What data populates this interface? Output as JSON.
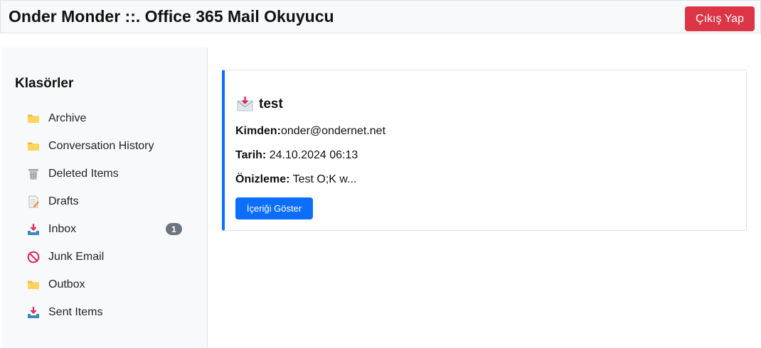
{
  "header": {
    "title": "Onder Monder ::. Office 365 Mail Okuyucu",
    "logout_label": "Çıkış Yap"
  },
  "sidebar": {
    "title": "Klasörler",
    "folders": [
      {
        "label": "Archive",
        "icon": "folder-icon",
        "badge": ""
      },
      {
        "label": "Conversation History",
        "icon": "folder-icon",
        "badge": ""
      },
      {
        "label": "Deleted Items",
        "icon": "trash-icon",
        "badge": ""
      },
      {
        "label": "Drafts",
        "icon": "drafts-icon",
        "badge": ""
      },
      {
        "label": "Inbox",
        "icon": "inbox-tray-icon",
        "badge": "1"
      },
      {
        "label": "Junk Email",
        "icon": "prohibited-icon",
        "badge": ""
      },
      {
        "label": "Outbox",
        "icon": "folder-icon",
        "badge": ""
      },
      {
        "label": "Sent Items",
        "icon": "inbox-tray-icon",
        "badge": ""
      }
    ]
  },
  "mail": {
    "icon": "incoming-envelope-icon",
    "subject": "test",
    "from_label": "Kimden:",
    "from_value": "onder@ondernet.net",
    "date_label": "Tarih:",
    "date_value": "24.10.2024 06:13",
    "preview_label": "Önizleme:",
    "preview_value": "Test O;K w...",
    "show_button_label": "İçeriği Göster"
  },
  "colors": {
    "accent": "#0d6efd",
    "danger": "#dc3545",
    "badge": "#6c757d",
    "sidebar_bg": "#f8f9fa"
  }
}
